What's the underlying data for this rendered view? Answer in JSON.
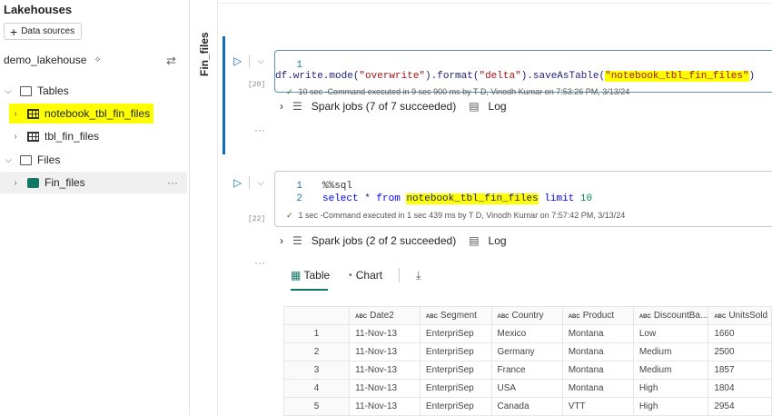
{
  "sidebar": {
    "title": "Lakehouses",
    "data_sources_label": "Data sources",
    "lakehouse": "demo_lakehouse",
    "tree": [
      {
        "label": "Tables",
        "kind": "folder",
        "expanded": true
      },
      {
        "label": "notebook_tbl_fin_files",
        "kind": "table",
        "highlighted": true
      },
      {
        "label": "tbl_fin_files",
        "kind": "table"
      },
      {
        "label": "Files",
        "kind": "folder",
        "expanded": true
      },
      {
        "label": "Fin_files",
        "kind": "file-folder",
        "selected": true
      }
    ],
    "more": "···"
  },
  "vertical_tab": "Fin_files",
  "cells": [
    {
      "exec": "[20]",
      "lines": [
        {
          "n": "1"
        }
      ],
      "code": {
        "p1": "df.write.mode(",
        "s1": "\"overwrite\"",
        "p2": ").format(",
        "s2": "\"delta\"",
        "p3": ").saveAsTable(",
        "s3": "\"notebook_tbl_fin_files\"",
        "p4": ")"
      },
      "status": "10 sec -Command executed in 9 sec 900 ms by T D, Vinodh Kumar on 7:53:26 PM, 3/13/24",
      "jobs": "Spark jobs (7 of 7 succeeded)",
      "log": "Log"
    },
    {
      "exec": "[22]",
      "lines": [
        {
          "n": "1",
          "text": "%%sql"
        },
        {
          "n": "2"
        }
      ],
      "code": {
        "k1": "select",
        "p1": " * ",
        "k2": "from",
        "t": "notebook_tbl_fin_files",
        "k3": "limit",
        "num": "10"
      },
      "status": "1 sec -Command executed in 1 sec 439 ms by T D, Vinodh Kumar on 7:57:42 PM, 3/13/24",
      "jobs": "Spark jobs (2 of 2 succeeded)",
      "log": "Log"
    }
  ],
  "more": "···",
  "result_tabs": {
    "table": "Table",
    "chart": "Chart"
  },
  "table": {
    "type_badge": "ABC",
    "columns": [
      "Date2",
      "Segment",
      "Country",
      "Product",
      "DiscountBa...",
      "UnitsSold"
    ],
    "rows": [
      [
        "1",
        "11-Nov-13",
        "EnterpriSep",
        "Mexico",
        "Montana",
        "Low",
        "1660"
      ],
      [
        "2",
        "11-Nov-13",
        "EnterpriSep",
        "Germany",
        "Montana",
        "Medium",
        "2500"
      ],
      [
        "3",
        "11-Nov-13",
        "EnterpriSep",
        "France",
        "Montana",
        "Medium",
        "1857"
      ],
      [
        "4",
        "11-Nov-13",
        "EnterpriSep",
        "USA",
        "Montana",
        "High",
        "1804"
      ],
      [
        "5",
        "11-Nov-13",
        "EnterpriSep",
        "Canada",
        "VTT",
        "High",
        "2954"
      ]
    ]
  },
  "colors": {
    "accent": "#0f6cbd",
    "green": "#117865",
    "highlight": "#ffff00"
  }
}
